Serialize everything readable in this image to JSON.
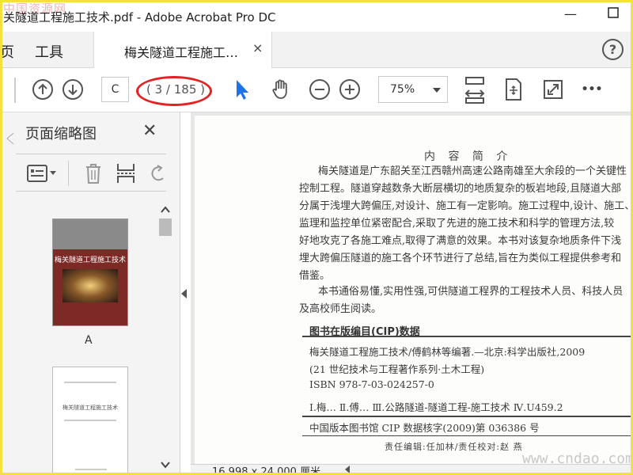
{
  "watermark": {
    "text": "中国资源网",
    "url": "www.cndao.com"
  },
  "window": {
    "title": "关隧道工程施工技术.pdf - Adobe Acrobat Pro DC",
    "minimize": "—",
    "maximize": "☐"
  },
  "tabs": {
    "home_partial": "页",
    "tools": "工具",
    "document": "梅关隧道工程施工…",
    "close": "×"
  },
  "toolbar": {
    "page_current": "C",
    "page_total": "( 3 / 185 )",
    "zoom": "75%",
    "more": "•••",
    "annotation_color": "#e02424",
    "select_color": "#1a73e8"
  },
  "panel": {
    "title": "页面缩略图",
    "close": "✕",
    "thumbs": [
      {
        "label": "A",
        "cover_title": "梅关隧道工程施工技术"
      },
      {
        "label": "",
        "cover_title": "梅关隧道工程施工技术"
      }
    ]
  },
  "document": {
    "heading": "内 容 简 介",
    "paragraph1": [
      "梅关隧道是广东韶关至江西赣州高速公路南雄至大余段的一个关键性",
      "控制工程。隧道穿越数条大断层横切的地质复杂的板岩地段,且隧道大部",
      "分属于浅埋大跨偏压,对设计、施工有一定影响。施工过程中,设计、施工、",
      "监理和监控单位紧密配合,采取了先进的施工技术和科学的管理方法,较",
      "好地攻克了各施工难点,取得了满意的效果。本书对该复杂地质条件下浅",
      "埋大跨偏压隧道的施工各个环节进行了总结,旨在为类似工程提供参考和",
      "借鉴。"
    ],
    "paragraph2": [
      "本书通俗易懂,实用性强,可供隧道工程界的工程技术人员、科技人员",
      "及高校师生阅读。"
    ],
    "cip_title": "图书在版编目(CIP)数据",
    "cip_lines": [
      "梅关隧道工程施工技术/傅鹤林等编著.—北京:科学出版社,2009",
      "(21 世纪技术与工程著作系列·土木工程)",
      "ISBN 978-7-03-024257-0",
      "Ⅰ.梅…  Ⅱ.傅…  Ⅲ.公路隧道-隧道工程-施工技术  Ⅳ.U459.2",
      "中国版本图书馆 CIP 数据核字(2009)第 036386 号"
    ],
    "editor": "责任编辑:任加林/责任校对:赵  燕"
  },
  "status": {
    "page_size": "16.998 x 24.000 厘米"
  }
}
